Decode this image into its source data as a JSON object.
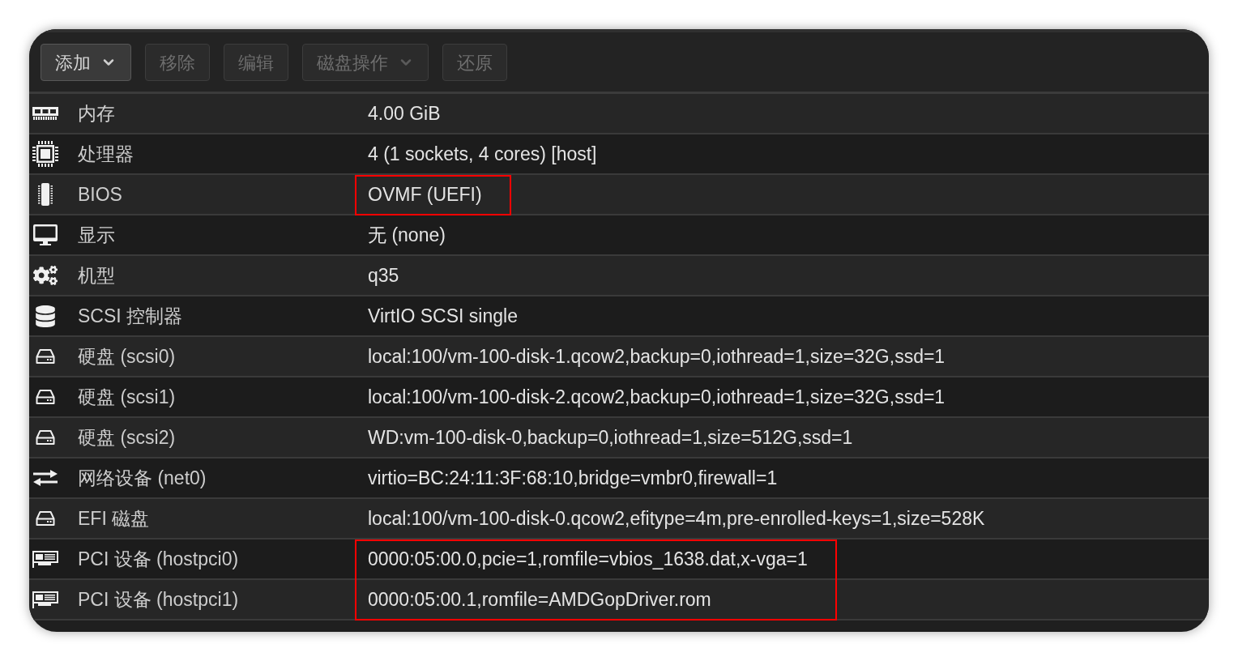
{
  "toolbar": [
    {
      "label": "添加",
      "kind": "menu",
      "disabled": false
    },
    {
      "label": "移除",
      "kind": "button",
      "disabled": true
    },
    {
      "label": "编辑",
      "kind": "button",
      "disabled": true
    },
    {
      "label": "磁盘操作",
      "kind": "menu",
      "disabled": true
    },
    {
      "label": "还原",
      "kind": "button",
      "disabled": true
    }
  ],
  "hardware": {
    "rows": [
      {
        "kind": "memory",
        "name": "内存",
        "value": "4.00 GiB",
        "highlighted": false
      },
      {
        "kind": "processor",
        "name": "处理器",
        "value": "4 (1 sockets, 4 cores) [host]",
        "highlighted": false
      },
      {
        "kind": "bios",
        "name": "BIOS",
        "value": "OVMF (UEFI)",
        "highlighted": true
      },
      {
        "kind": "display",
        "name": "显示",
        "value": "无 (none)",
        "highlighted": false
      },
      {
        "kind": "machine",
        "name": "机型",
        "value": "q35",
        "highlighted": false
      },
      {
        "kind": "controller",
        "name": "SCSI 控制器",
        "value": "VirtIO SCSI single",
        "highlighted": false
      },
      {
        "kind": "disk",
        "name": "硬盘 (scsi0)",
        "value": "local:100/vm-100-disk-1.qcow2,backup=0,iothread=1,size=32G,ssd=1",
        "highlighted": false
      },
      {
        "kind": "disk",
        "name": "硬盘 (scsi1)",
        "value": "local:100/vm-100-disk-2.qcow2,backup=0,iothread=1,size=32G,ssd=1",
        "highlighted": false
      },
      {
        "kind": "disk",
        "name": "硬盘 (scsi2)",
        "value": "WD:vm-100-disk-0,backup=0,iothread=1,size=512G,ssd=1",
        "highlighted": false
      },
      {
        "kind": "network",
        "name": "网络设备 (net0)",
        "value": "virtio=BC:24:11:3F:68:10,bridge=vmbr0,firewall=1",
        "highlighted": false
      },
      {
        "kind": "disk",
        "name": "EFI 磁盘",
        "value": "local:100/vm-100-disk-0.qcow2,efitype=4m,pre-enrolled-keys=1,size=528K",
        "highlighted": false
      },
      {
        "kind": "pci",
        "name": "PCI 设备 (hostpci0)",
        "value": "0000:05:00.0,pcie=1,romfile=vbios_1638.dat,x-vga=1",
        "highlighted": true
      },
      {
        "kind": "pci",
        "name": "PCI 设备 (hostpci1)",
        "value": "0000:05:00.1,romfile=AMDGopDriver.rom",
        "highlighted": true
      }
    ]
  }
}
